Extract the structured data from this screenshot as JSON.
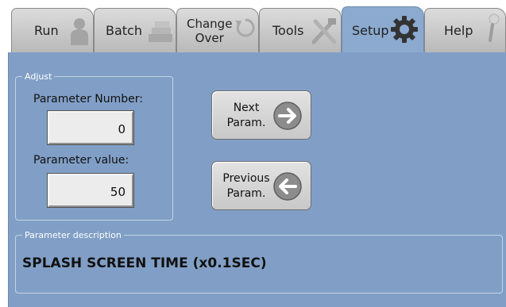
{
  "tabs": [
    {
      "label": "Run",
      "icon": "person-icon",
      "active": false
    },
    {
      "label": "Batch",
      "icon": "batch-icon",
      "active": false
    },
    {
      "label": "Change\nOver",
      "icon": "changeover-icon",
      "active": false
    },
    {
      "label": "Tools",
      "icon": "tools-icon",
      "active": false
    },
    {
      "label": "Setup",
      "icon": "gear-icon",
      "active": true
    },
    {
      "label": "Help",
      "icon": "help-icon",
      "active": false
    }
  ],
  "adjust": {
    "legend": "Adjust",
    "param_number_label": "Parameter Number:",
    "param_number_value": "0",
    "param_value_label": "Parameter value:",
    "param_value_value": "50"
  },
  "buttons": {
    "next_label": "Next\nParam.",
    "previous_label": "Previous\nParam."
  },
  "description": {
    "legend": "Parameter description",
    "text": "SPLASH SCREEN TIME (x0.1SEC)"
  },
  "colors": {
    "panel": "#819fc6",
    "active_tab": "#8caacf",
    "inactive_tab": "#cbcbcb",
    "group_border": "#c4d2e4"
  }
}
